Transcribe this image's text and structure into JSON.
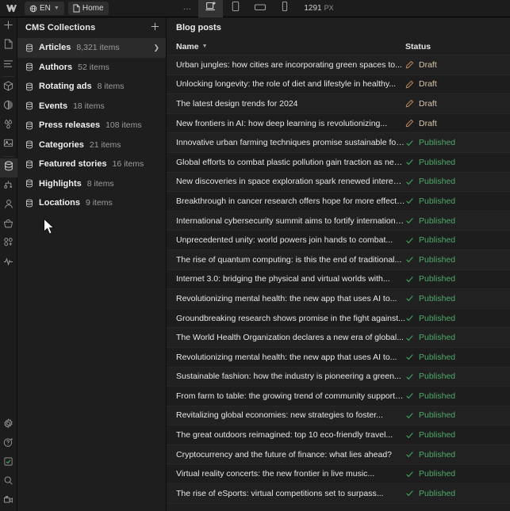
{
  "topbar": {
    "logo_icon": "webflow-logo-icon",
    "locale": {
      "label": "EN",
      "icon": "globe-icon",
      "chevron": "chevron-down-icon"
    },
    "page": {
      "label": "Home",
      "icon": "page-icon"
    },
    "overflow": "…",
    "breakpoints": [
      {
        "name": "desktop",
        "icon": "desktop-breakpoint-icon",
        "active": true
      },
      {
        "name": "tablet",
        "icon": "tablet-breakpoint-icon",
        "active": false
      },
      {
        "name": "mobile-landscape",
        "icon": "mobile-landscape-breakpoint-icon",
        "active": false
      },
      {
        "name": "mobile-portrait",
        "icon": "mobile-portrait-breakpoint-icon",
        "active": false
      }
    ],
    "viewport": {
      "value": "1291",
      "unit": "PX"
    }
  },
  "rail": {
    "top": [
      {
        "name": "add-panel",
        "icon": "plus-icon",
        "active": false
      },
      {
        "name": "pages-panel",
        "icon": "page-icon",
        "active": false
      },
      {
        "name": "navigator-panel",
        "icon": "layers-icon",
        "active": false
      }
    ],
    "middle": [
      {
        "name": "components-panel",
        "icon": "cube-icon",
        "active": false
      },
      {
        "name": "style-panel",
        "icon": "paint-icon",
        "active": false
      },
      {
        "name": "variables-panel",
        "icon": "droplets-icon",
        "active": false
      },
      {
        "name": "assets-panel",
        "icon": "image-icon",
        "active": false
      }
    ],
    "lower": [
      {
        "name": "cms-panel",
        "icon": "database-icon",
        "active": true
      },
      {
        "name": "logic-panel",
        "icon": "logic-flow-icon",
        "active": false
      },
      {
        "name": "users-panel",
        "icon": "user-icon",
        "active": false
      },
      {
        "name": "ecommerce-panel",
        "icon": "basket-icon",
        "active": false
      },
      {
        "name": "apps-panel",
        "icon": "apps-plus-icon",
        "active": false
      },
      {
        "name": "audit-panel",
        "icon": "activity-icon",
        "active": false
      }
    ],
    "bottom": [
      {
        "name": "settings",
        "icon": "gear-icon",
        "active": false
      },
      {
        "name": "help",
        "icon": "help-icon",
        "active": false
      },
      {
        "name": "checklist",
        "icon": "checkbox-checked-icon",
        "active": false
      },
      {
        "name": "search",
        "icon": "search-icon",
        "active": false
      },
      {
        "name": "video",
        "icon": "video-camera-icon",
        "active": false
      }
    ]
  },
  "collections_panel": {
    "title": "CMS Collections",
    "add_icon": "plus-icon",
    "items": [
      {
        "name": "Articles",
        "count": "8,321 items",
        "selected": true
      },
      {
        "name": "Authors",
        "count": "52 items",
        "selected": false
      },
      {
        "name": "Rotating ads",
        "count": "8 items",
        "selected": false
      },
      {
        "name": "Events",
        "count": "18 items",
        "selected": false
      },
      {
        "name": "Press releases",
        "count": "108 items",
        "selected": false
      },
      {
        "name": "Categories",
        "count": "21 items",
        "selected": false
      },
      {
        "name": "Featured stories",
        "count": "16 items",
        "selected": false
      },
      {
        "name": "Highlights",
        "count": "8 items",
        "selected": false
      },
      {
        "name": "Locations",
        "count": "9 items",
        "selected": false
      }
    ]
  },
  "main": {
    "title": "Blog posts",
    "columns": {
      "name": "Name",
      "status": "Status"
    },
    "sort_icon": "chevron-down-icon",
    "status_icons": {
      "draft": "pencil-icon",
      "published": "check-icon"
    },
    "status_colors": {
      "draft": "#c08a5c",
      "published": "#3f9e5e"
    },
    "rows": [
      {
        "name": "Urban jungles: how cities are incorporating green spaces to...",
        "status": "Draft",
        "state": "draft"
      },
      {
        "name": "Unlocking longevity: the role of diet and lifestyle in healthy...",
        "status": "Draft",
        "state": "draft"
      },
      {
        "name": "The latest design trends for 2024",
        "status": "Draft",
        "state": "draft"
      },
      {
        "name": "New frontiers in AI: how deep learning is revolutionizing...",
        "status": "Draft",
        "state": "draft"
      },
      {
        "name": "Innovative urban farming techniques promise sustainable food...",
        "status": "Published",
        "state": "published"
      },
      {
        "name": "Global efforts to combat plastic pollution gain traction as new...",
        "status": "Published",
        "state": "published"
      },
      {
        "name": "New discoveries in space exploration spark renewed interest...",
        "status": "Published",
        "state": "published"
      },
      {
        "name": "Breakthrough in cancer research offers hope for more effective...",
        "status": "Published",
        "state": "published"
      },
      {
        "name": "International cybersecurity summit aims to fortify international...",
        "status": "Published",
        "state": "published"
      },
      {
        "name": "Unprecedented unity: world powers join hands to combat...",
        "status": "Published",
        "state": "published"
      },
      {
        "name": "The rise of quantum computing: is this the end of traditional...",
        "status": "Published",
        "state": "published"
      },
      {
        "name": "Internet 3.0: bridging the physical and virtual worlds with...",
        "status": "Published",
        "state": "published"
      },
      {
        "name": "Revolutionizing mental health: the new app that uses AI to...",
        "status": "Published",
        "state": "published"
      },
      {
        "name": "Groundbreaking research shows promise in the fight against...",
        "status": "Published",
        "state": "published"
      },
      {
        "name": "The World Health Organization declares a new era of global...",
        "status": "Published",
        "state": "published"
      },
      {
        "name": "Revolutionizing mental health: the new app that uses AI to...",
        "status": "Published",
        "state": "published"
      },
      {
        "name": "Sustainable fashion: how the industry is pioneering a green...",
        "status": "Published",
        "state": "published"
      },
      {
        "name": "From farm to table: the growing trend of community supported...",
        "status": "Published",
        "state": "published"
      },
      {
        "name": "Revitalizing global economies: new strategies to foster...",
        "status": "Published",
        "state": "published"
      },
      {
        "name": "The great outdoors reimagined: top 10 eco-friendly travel...",
        "status": "Published",
        "state": "published"
      },
      {
        "name": "Cryptocurrency and the future of finance: what lies ahead?",
        "status": "Published",
        "state": "published"
      },
      {
        "name": "Virtual reality concerts: the new frontier in live music...",
        "status": "Published",
        "state": "published"
      },
      {
        "name": "The rise of eSports: virtual competitions set to surpass...",
        "status": "Published",
        "state": "published"
      }
    ]
  }
}
